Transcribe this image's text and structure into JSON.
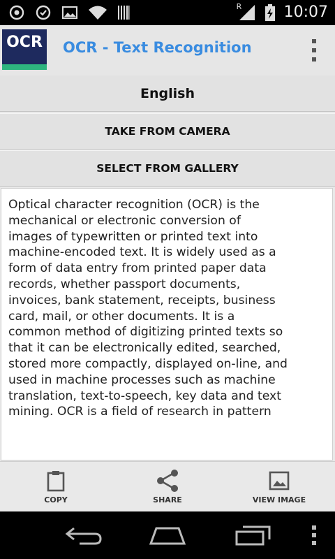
{
  "status_bar": {
    "time": "10:07",
    "roaming_indicator": "R",
    "icons": [
      "sync-icon",
      "sync-icon",
      "image-icon",
      "wifi-icon",
      "barcode-icon",
      "signal-icon",
      "battery-charging-icon"
    ]
  },
  "action_bar": {
    "logo_text": "OCR",
    "title": "OCR - Text Recognition",
    "overflow_icon": "overflow-menu-icon"
  },
  "buttons": {
    "language": "English",
    "camera": "TAKE FROM CAMERA",
    "gallery": "SELECT FROM GALLERY"
  },
  "result_text": "Optical character recognition (OCR) is the mechanical or electronic conversion of images of typewritten or printed text into machine-encoded text. It is widely used as a form of data entry from printed paper data records, whether passport documents, invoices, bank statement, receipts, business card, mail, or other documents. It is a common method of digitizing printed texts so that it can be electronically edited, searched, stored more compactly, displayed on-line, and used in machine processes such as machine translation, text-to-speech, key data and text mining. OCR is a field of research in pattern",
  "toolbar": {
    "copy": "COPY",
    "share": "SHARE",
    "view_image": "VIEW IMAGE"
  },
  "nav_bar": {
    "icons": [
      "back-icon",
      "home-icon",
      "recents-icon",
      "menu-icon"
    ]
  },
  "colors": {
    "title": "#3a8ce0",
    "logo_bg": "#1e2a5e",
    "logo_accent": "#2eb57f"
  }
}
